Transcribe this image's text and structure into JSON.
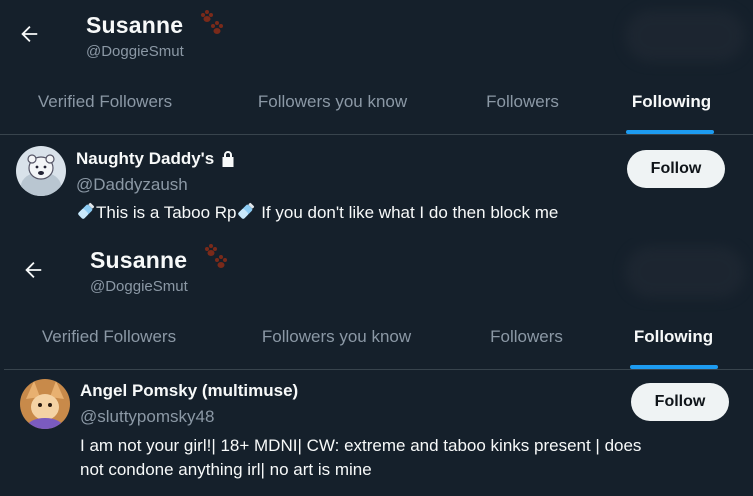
{
  "panels": [
    {
      "profile": {
        "name": "Susanne",
        "handle": "@DoggieSmut"
      },
      "tabs": [
        "Verified Followers",
        "Followers you know",
        "Followers",
        "Following"
      ],
      "active_tab": "Following",
      "user": {
        "name": "Naughty Daddy's",
        "locked": true,
        "handle": "@Daddyzaush",
        "bio_parts": [
          "This is a Taboo Rp",
          " If you don't like what I do then block me"
        ],
        "follow_label": "Follow"
      }
    },
    {
      "profile": {
        "name": "Susanne",
        "handle": "@DoggieSmut"
      },
      "tabs": [
        "Verified Followers",
        "Followers you know",
        "Followers",
        "Following"
      ],
      "active_tab": "Following",
      "user": {
        "name": "Angel Pomsky (multimuse)",
        "handle": "@sluttypomsky48",
        "bio_line1": "I am not your girl!| 18+ MDNI| CW: extreme and taboo kinks present | does",
        "bio_line2": "not condone anything irl| no art is mine",
        "follow_label": "Follow"
      }
    }
  ],
  "colors": {
    "bg": "#15202b",
    "accent": "#1d9bf0",
    "muted": "#8b98a5",
    "paw": "#7a2a1a"
  },
  "icons": {
    "back": "arrow-left-icon",
    "paw": "paw-prints-icon",
    "lock": "lock-icon",
    "bottle": "baby-bottle-icon"
  }
}
